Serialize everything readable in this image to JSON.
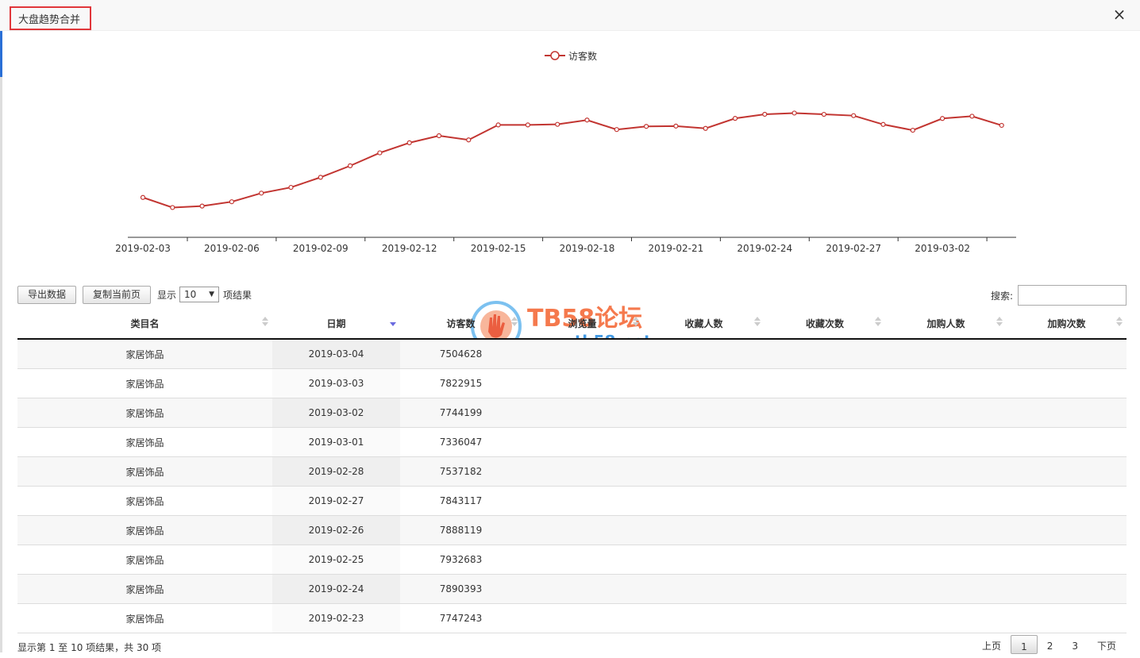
{
  "dialog": {
    "title": "大盘趋势合并",
    "close_icon": "×"
  },
  "chart_data": {
    "type": "line",
    "legend": "访客数",
    "legend_position": "top-center",
    "series_color": "#c23531",
    "x": [
      "2019-02-03",
      "2019-02-04",
      "2019-02-05",
      "2019-02-06",
      "2019-02-07",
      "2019-02-08",
      "2019-02-09",
      "2019-02-10",
      "2019-02-11",
      "2019-02-12",
      "2019-02-13",
      "2019-02-14",
      "2019-02-15",
      "2019-02-16",
      "2019-02-17",
      "2019-02-18",
      "2019-02-19",
      "2019-02-20",
      "2019-02-21",
      "2019-02-22",
      "2019-02-23",
      "2019-02-24",
      "2019-02-25",
      "2019-02-26",
      "2019-02-27",
      "2019-02-28",
      "2019-03-01",
      "2019-03-02",
      "2019-03-03",
      "2019-03-04"
    ],
    "xticks": [
      "2019-02-03",
      "2019-02-06",
      "2019-02-09",
      "2019-02-12",
      "2019-02-15",
      "2019-02-18",
      "2019-02-21",
      "2019-02-24",
      "2019-02-27",
      "2019-03-02"
    ],
    "y_estimated": [
      5000000,
      4650000,
      4700000,
      4850000,
      5150000,
      5350000,
      5700000,
      6100000,
      6550000,
      6900000,
      7144000,
      7000000,
      7520000,
      7520000,
      7540000,
      7690000,
      7360000,
      7470000,
      7480000,
      7400000,
      7747243,
      7890393,
      7932683,
      7888119,
      7843117,
      7537182,
      7336047,
      7744199,
      7822915,
      7504628
    ],
    "yaxis_visible": false,
    "grid": false
  },
  "controls": {
    "export_label": "导出数据",
    "copy_label": "复制当前页",
    "show_label": "显示",
    "page_size": "10",
    "page_size_arrow": "▼",
    "suffix_label": "项结果",
    "search_label": "搜索:",
    "search_value": ""
  },
  "table": {
    "columns": [
      "类目名",
      "日期",
      "访客数",
      "浏览量",
      "收藏人数",
      "收藏次数",
      "加购人数",
      "加购次数"
    ],
    "rows": [
      [
        "家居饰品",
        "2019-03-04",
        "7504628",
        "",
        "",
        "",
        "",
        ""
      ],
      [
        "家居饰品",
        "2019-03-03",
        "7822915",
        "",
        "",
        "",
        "",
        ""
      ],
      [
        "家居饰品",
        "2019-03-02",
        "7744199",
        "",
        "",
        "",
        "",
        ""
      ],
      [
        "家居饰品",
        "2019-03-01",
        "7336047",
        "",
        "",
        "",
        "",
        ""
      ],
      [
        "家居饰品",
        "2019-02-28",
        "7537182",
        "",
        "",
        "",
        "",
        ""
      ],
      [
        "家居饰品",
        "2019-02-27",
        "7843117",
        "",
        "",
        "",
        "",
        ""
      ],
      [
        "家居饰品",
        "2019-02-26",
        "7888119",
        "",
        "",
        "",
        "",
        ""
      ],
      [
        "家居饰品",
        "2019-02-25",
        "7932683",
        "",
        "",
        "",
        "",
        ""
      ],
      [
        "家居饰品",
        "2019-02-24",
        "7890393",
        "",
        "",
        "",
        "",
        ""
      ],
      [
        "家居饰品",
        "2019-02-23",
        "7747243",
        "",
        "",
        "",
        "",
        ""
      ]
    ]
  },
  "footer": {
    "info": "显示第 1 至 10 项结果，共 30 项",
    "prev": "上页",
    "pages": [
      "1",
      "2",
      "3"
    ],
    "current_page": "1",
    "next": "下页"
  },
  "watermark": {
    "title": "TB58论坛",
    "url": "www.tb58.net"
  }
}
